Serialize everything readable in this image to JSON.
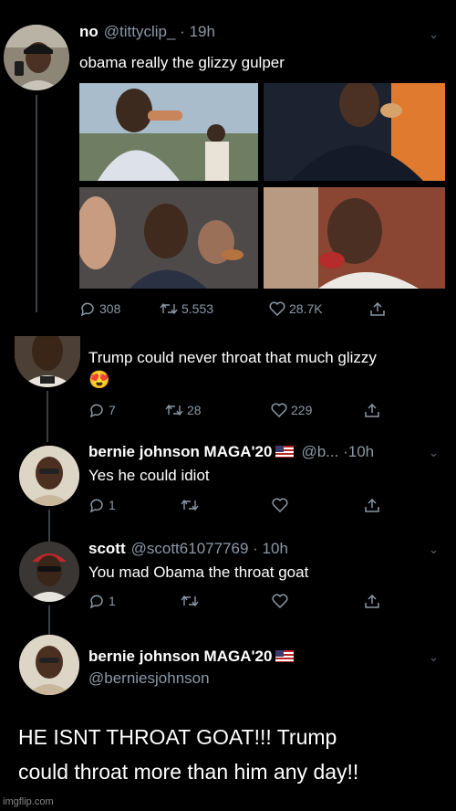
{
  "tweet1": {
    "name": "no",
    "handle": "@tittyclip_",
    "time": "19h",
    "text": "obama really the glizzy gulper",
    "stats": {
      "replies": "308",
      "retweets": "5.553",
      "likes": "28.7K"
    }
  },
  "reply1": {
    "text": "Trump could never throat that much glizzy",
    "emoji": "😍",
    "stats": {
      "replies": "7",
      "retweets": "28",
      "likes": "229"
    }
  },
  "reply2": {
    "name": "bernie johnson MAGA'20",
    "handle": "@b...",
    "time": "10h",
    "text": "Yes he could idiot",
    "stats": {
      "replies": "1"
    }
  },
  "reply3": {
    "name": "scott",
    "handle": "@scott61077769",
    "time": "10h",
    "text": "You mad Obama the throat goat",
    "stats": {
      "replies": "1"
    }
  },
  "reply4": {
    "name": "bernie johnson MAGA'20",
    "handle": "@berniesjohnson",
    "text_line1": "HE ISNT THROAT GOAT!!! Trump",
    "text_line2": "could throat more than him any day!!"
  },
  "watermark": "imgflip.com",
  "colors": {
    "background": "#000000",
    "muted": "#8b98a5",
    "thread_line": "#3a3f44"
  }
}
